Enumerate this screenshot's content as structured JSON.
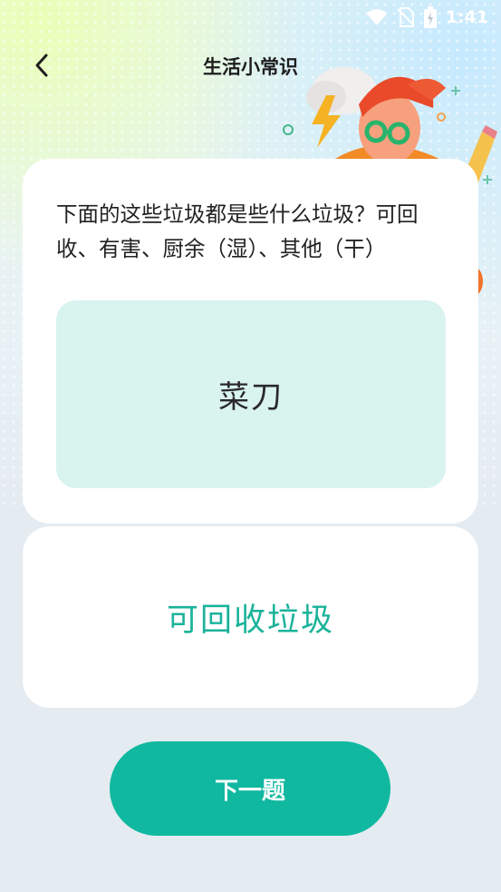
{
  "status_bar": {
    "time": "1:41",
    "icons": [
      "wifi-icon",
      "no-sim-icon",
      "battery-charging-icon"
    ]
  },
  "nav": {
    "back_icon": "chevron-left-icon",
    "title": "生活小常识"
  },
  "question": {
    "text": "下面的这些垃圾都是些什么垃圾？可回收、有害、厨余（湿）、其他（干）",
    "item": "菜刀"
  },
  "answer": {
    "text": "可回收垃圾"
  },
  "actions": {
    "next_label": "下一题"
  },
  "colors": {
    "accent": "#10b8a0",
    "answer_text": "#1bb39a",
    "item_box_bg": "#d9f3ee",
    "page_bg": "#e4ebf1"
  }
}
